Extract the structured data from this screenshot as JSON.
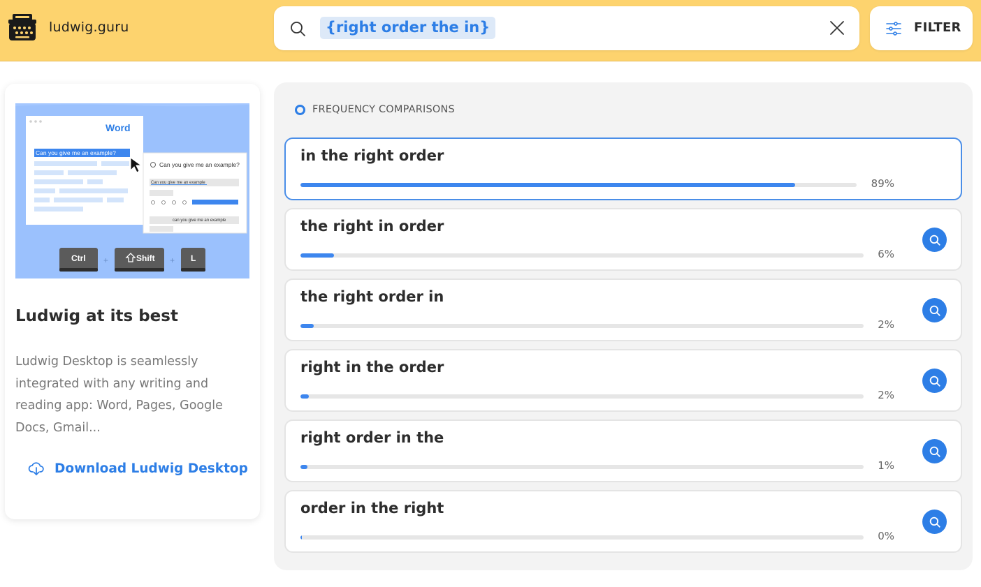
{
  "header": {
    "brand": "ludwig.guru",
    "search_query": "{right order the in}",
    "filter_label": "FILTER"
  },
  "promo": {
    "illustration": {
      "word_label": "Word",
      "highlight_text": "Can you give me an example?",
      "popup_question": "Can you give me an example?",
      "popup_item_1": "Can you give me an example",
      "popup_item_2": "can you give me an example",
      "key_ctrl": "Ctrl",
      "key_shift": "Shift",
      "key_l": "L"
    },
    "title": "Ludwig at its best",
    "description": "Ludwig Desktop is seamlessly integrated with any writing and reading app: Word, Pages, Google Docs, Gmail...",
    "link_label": "Download Ludwig Desktop"
  },
  "results": {
    "section_title": "FREQUENCY COMPARISONS",
    "items": [
      {
        "phrase": "in the right order",
        "percent_label": "89%",
        "percent": 89,
        "active": true
      },
      {
        "phrase": "the right in order",
        "percent_label": "6%",
        "percent": 6,
        "active": false
      },
      {
        "phrase": "the right order in",
        "percent_label": "2%",
        "percent": 2.3,
        "active": false
      },
      {
        "phrase": "right in the order",
        "percent_label": "2%",
        "percent": 1.5,
        "active": false
      },
      {
        "phrase": "right order in the",
        "percent_label": "1%",
        "percent": 1.3,
        "active": false
      },
      {
        "phrase": "order in the right",
        "percent_label": "0%",
        "percent": 0.3,
        "active": false
      }
    ]
  },
  "colors": {
    "header_bg": "#fdd36e",
    "accent": "#2d7ee6",
    "bar_fill": "#3d86ee",
    "panel_bg": "#f3f3f3"
  }
}
